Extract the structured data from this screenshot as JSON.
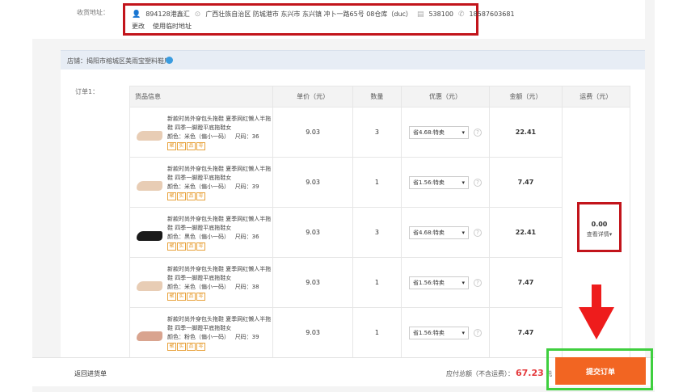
{
  "address": {
    "label": "收货地址：",
    "recipient": "894128港鑫汇",
    "location": "广西壮族自治区 防城港市 东兴市 东兴镇 冲卜一路65号 08仓库（duc）",
    "postcode": "538100",
    "phone": "18587603681",
    "change_label": "更改",
    "temp_label": "使用临时地址"
  },
  "shop": {
    "label": "店铺：揭阳市榕城区美雨宝塑料鞋厂"
  },
  "order": {
    "label": "订单1：",
    "headers": [
      "货品信息",
      "单价（元）",
      "数量",
      "优惠（元）",
      "金额（元）",
      "运费（元）"
    ],
    "items": [
      {
        "title": "新款时尚外穿包头拖鞋 夏季网红懒人半拖鞋 四季一脚蹬平底拖鞋女",
        "spec": "颜色：米色（偏小一码）",
        "size": "尺码：36",
        "price": "9.03",
        "qty": "3",
        "discount": "省4.68:特卖",
        "amount": "22.41",
        "shoe_color": "#e8cdb5"
      },
      {
        "title": "新款时尚外穿包头拖鞋 夏季网红懒人半拖鞋 四季一脚蹬平底拖鞋女",
        "spec": "颜色：米色（偏小一码）",
        "size": "尺码：39",
        "price": "9.03",
        "qty": "1",
        "discount": "省1.56:特卖",
        "amount": "7.47",
        "shoe_color": "#e8cdb5"
      },
      {
        "title": "新款时尚外穿包头拖鞋 夏季网红懒人半拖鞋 四季一脚蹬平底拖鞋女",
        "spec": "颜色：黑色（偏小一码）",
        "size": "尺码：36",
        "price": "9.03",
        "qty": "3",
        "discount": "省4.68:特卖",
        "amount": "22.41",
        "shoe_color": "#1a1a1a"
      },
      {
        "title": "新款时尚外穿包头拖鞋 夏季网红懒人半拖鞋 四季一脚蹬平底拖鞋女",
        "spec": "颜色：米色（偏小一码）",
        "size": "尺码：38",
        "price": "9.03",
        "qty": "1",
        "discount": "省1.56:特卖",
        "amount": "7.47",
        "shoe_color": "#e8cdb5"
      },
      {
        "title": "新款时尚外穿包头拖鞋 夏季网红懒人半拖鞋 四季一脚蹬平底拖鞋女",
        "spec": "颜色：粉色（偏小一码）",
        "size": "尺码：39",
        "price": "9.03",
        "qty": "1",
        "discount": "省1.56:特卖",
        "amount": "7.47",
        "shoe_color": "#d9a48f"
      }
    ],
    "badges": [
      "聚",
      "实",
      "品",
      "零"
    ],
    "shipping_amount": "0.00",
    "shipping_link": "查看详情▾"
  },
  "footer": {
    "back_label": "返回进货单",
    "total_label": "应付总额（不含运费）：",
    "total_value": "67.23",
    "total_unit": "元",
    "submit_label": "提交订单"
  },
  "colors": {
    "accent": "#f26522",
    "highlight_red": "#c2141b",
    "highlight_green": "#3fcf3f"
  }
}
